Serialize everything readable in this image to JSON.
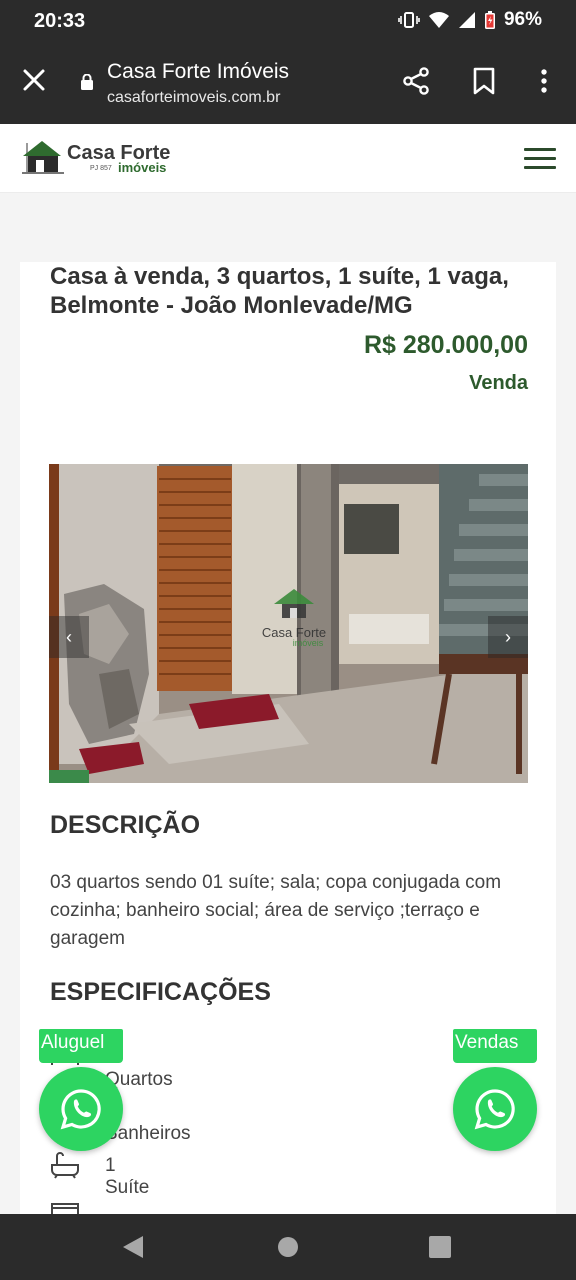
{
  "status": {
    "time": "20:33",
    "battery": "96%"
  },
  "browser": {
    "title": "Casa Forte Imóveis",
    "url": "casaforteimoveis.com.br"
  },
  "site": {
    "logo_name": "Casa Forte",
    "logo_sub": "imóveis",
    "logo_reg": "PJ 857"
  },
  "property": {
    "title": "Casa à venda, 3 quartos, 1 suíte, 1 vaga, Belmonte - João Monlevade/MG",
    "price": "R$ 280.000,00",
    "type": "Venda"
  },
  "gallery": {
    "watermark": "Casa Forte",
    "watermark_sub": "imóveis",
    "prev": "‹",
    "next": "›"
  },
  "description": {
    "heading": "DESCRIÇÃO",
    "text": "03 quartos sendo 01 suíte; sala; copa conjugada com cozinha; banheiro social; área de serviço ;terraço e garagem"
  },
  "specifications": {
    "heading": "ESPECIFICAÇÕES",
    "items": [
      {
        "label": "3 Quartos",
        "icon": "bed-icon"
      },
      {
        "label": "2 Banheiros",
        "icon": "shower-icon"
      },
      {
        "label": "1 Suíte",
        "icon": "bathtub-icon"
      }
    ]
  },
  "whatsapp": {
    "left_label": "Aluguel",
    "right_label": "Vendas",
    "color": "#2dd461"
  },
  "colors": {
    "accent": "#2d5a2d",
    "chrome": "#2b2b2b"
  }
}
